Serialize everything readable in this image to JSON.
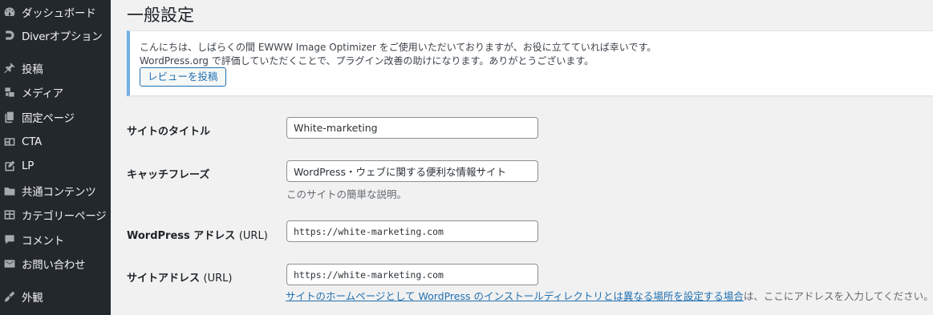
{
  "sidebar": {
    "items": [
      {
        "label": "ダッシュボード",
        "icon": "dashboard-icon"
      },
      {
        "label": "Diverオプション",
        "icon": "diver-logo-icon"
      },
      {
        "label": "投稿",
        "icon": "pushpin-icon"
      },
      {
        "label": "メディア",
        "icon": "media-icon"
      },
      {
        "label": "固定ページ",
        "icon": "page-icon"
      },
      {
        "label": "CTA",
        "icon": "id-card-icon"
      },
      {
        "label": "LP",
        "icon": "edit-icon"
      },
      {
        "label": "共通コンテンツ",
        "icon": "folder-icon"
      },
      {
        "label": "カテゴリーページ",
        "icon": "grid-icon"
      },
      {
        "label": "コメント",
        "icon": "comment-icon"
      },
      {
        "label": "お問い合わせ",
        "icon": "mail-icon"
      },
      {
        "label": "外観",
        "icon": "appearance-icon"
      }
    ]
  },
  "page": {
    "title": "一般設定"
  },
  "notice": {
    "line1": "こんにちは、しばらくの間 EWWW Image Optimizer をご使用いただいておりますが、お役に立てていれば幸いです。",
    "line2": "WordPress.org で評価していただくことで、プラグイン改善の助けになります。ありがとうございます。",
    "button_label": "レビューを投稿"
  },
  "settings": {
    "site_title": {
      "label": "サイトのタイトル",
      "value": "White-marketing"
    },
    "tagline": {
      "label": "キャッチフレーズ",
      "value": "WordPress・ウェブに関する便利な情報サイト",
      "description": "このサイトの簡単な説明。"
    },
    "wp_address": {
      "label": "WordPress アドレス",
      "unit": "(URL)",
      "value": "https://white-marketing.com"
    },
    "site_address": {
      "label": "サイトアドレス",
      "unit": "(URL)",
      "value": "https://white-marketing.com",
      "help_link": "サイトのホームページとして WordPress のインストールディレクトリとは異なる場所を設定する場合",
      "help_suffix": "は、ここにアドレスを入力してください。"
    }
  },
  "colors": {
    "sidebar_bg": "#23282d",
    "accent": "#2271b1",
    "notice_border": "#72aee6"
  }
}
